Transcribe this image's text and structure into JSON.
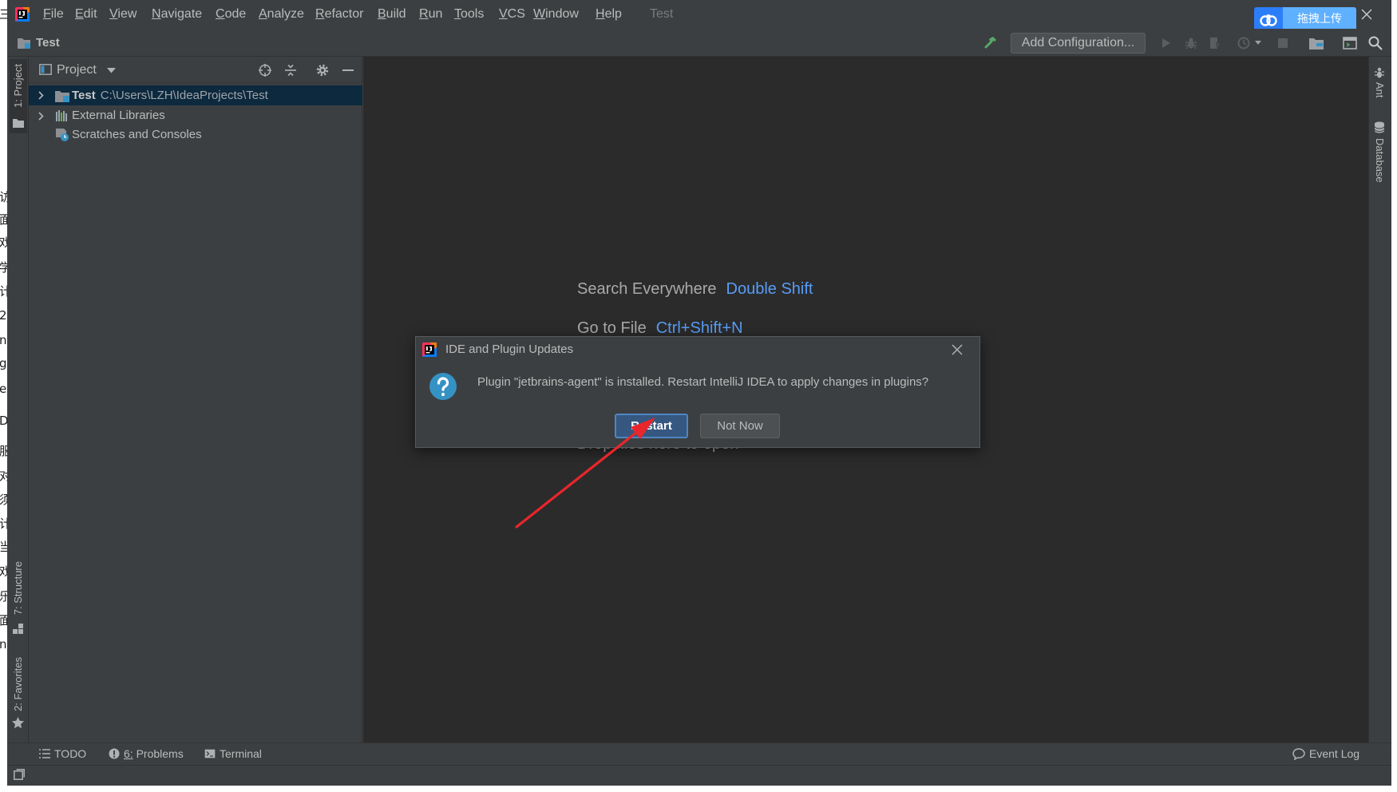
{
  "background_window": {
    "fragments": [
      "三",
      "访",
      "面",
      "戏",
      "学",
      "计",
      "2",
      "ns",
      "gs",
      "ey",
      "D",
      "服",
      "对",
      "须",
      "计",
      "当",
      "戏",
      "乐",
      "面",
      "n"
    ]
  },
  "menu": {
    "items": [
      "File",
      "Edit",
      "View",
      "Navigate",
      "Code",
      "Analyze",
      "Refactor",
      "Build",
      "Run",
      "Tools",
      "VCS",
      "Window",
      "Help"
    ],
    "project_title": "Test"
  },
  "upload_widget": {
    "label": "拖拽上传"
  },
  "toolbar": {
    "project_name": "Test",
    "add_configuration_label": "Add Configuration..."
  },
  "left_tool_strip": {
    "project_tab": "1: Project",
    "structure_tab": "7: Structure",
    "favorites_tab": "2: Favorites"
  },
  "right_tool_strip": {
    "ant_tab": "Ant",
    "database_tab": "Database"
  },
  "project_panel": {
    "title": "Project",
    "tree": [
      {
        "label": "Test",
        "path": "C:\\Users\\LZH\\IdeaProjects\\Test",
        "selected": true,
        "expandable": true
      },
      {
        "label": "External Libraries",
        "expandable": true
      },
      {
        "label": "Scratches and Consoles",
        "expandable": false
      }
    ]
  },
  "editor": {
    "hints": [
      {
        "label": "Search Everywhere",
        "shortcut": "Double Shift"
      },
      {
        "label": "Go to File",
        "shortcut": "Ctrl+Shift+N"
      }
    ],
    "drop_hint": "Drop files here to open"
  },
  "dialog": {
    "title": "IDE and Plugin Updates",
    "message": "Plugin \"jetbrains-agent\" is installed. Restart IntelliJ IDEA to apply changes in plugins?",
    "restart_label": "Restart",
    "not_now_label": "Not Now"
  },
  "bottom_tool_bar": {
    "todo": "TODO",
    "problems": "6: Problems",
    "terminal": "Terminal",
    "event_log": "Event Log"
  },
  "colors": {
    "chrome_background": "#3c3f41",
    "editor_background": "#2b2b2b",
    "text": "#bbbbbb",
    "shortcut": "#589df6",
    "selection": "#0d293e",
    "primary_button": "#365880",
    "annotation_arrow": "#e8262b"
  }
}
